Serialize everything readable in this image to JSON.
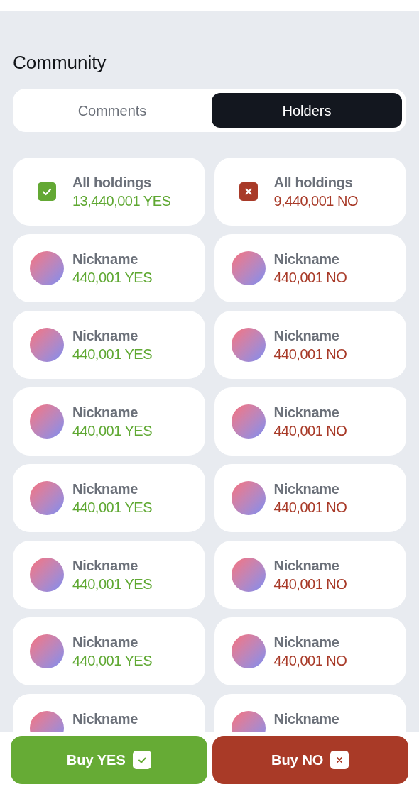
{
  "section_title": "Community",
  "tabs": [
    {
      "label": "Comments",
      "selected": false
    },
    {
      "label": "Holders",
      "selected": true
    }
  ],
  "holders": {
    "yes": [
      {
        "kind": "total",
        "label": "All holdings",
        "amount": "13,440,001 YES"
      },
      {
        "kind": "holder",
        "label": "Nickname",
        "amount": "440,001 YES"
      },
      {
        "kind": "holder",
        "label": "Nickname",
        "amount": "440,001 YES"
      },
      {
        "kind": "holder",
        "label": "Nickname",
        "amount": "440,001 YES"
      },
      {
        "kind": "holder",
        "label": "Nickname",
        "amount": "440,001 YES"
      },
      {
        "kind": "holder",
        "label": "Nickname",
        "amount": "440,001 YES"
      },
      {
        "kind": "holder",
        "label": "Nickname",
        "amount": "440,001 YES"
      },
      {
        "kind": "holder",
        "label": "Nickname"
      }
    ],
    "no": [
      {
        "kind": "total",
        "label": "All holdings",
        "amount": "9,440,001 NO"
      },
      {
        "kind": "holder",
        "label": "Nickname",
        "amount": "440,001 NO"
      },
      {
        "kind": "holder",
        "label": "Nickname",
        "amount": "440,001 NO"
      },
      {
        "kind": "holder",
        "label": "Nickname",
        "amount": "440,001 NO"
      },
      {
        "kind": "holder",
        "label": "Nickname",
        "amount": "440,001 NO"
      },
      {
        "kind": "holder",
        "label": "Nickname",
        "amount": "440,001 NO"
      },
      {
        "kind": "holder",
        "label": "Nickname",
        "amount": "440,001 NO"
      },
      {
        "kind": "holder",
        "label": "Nickname"
      }
    ]
  },
  "actions": [
    {
      "kind": "yes",
      "label": "Buy YES"
    },
    {
      "kind": "no",
      "label": "Buy NO"
    }
  ]
}
